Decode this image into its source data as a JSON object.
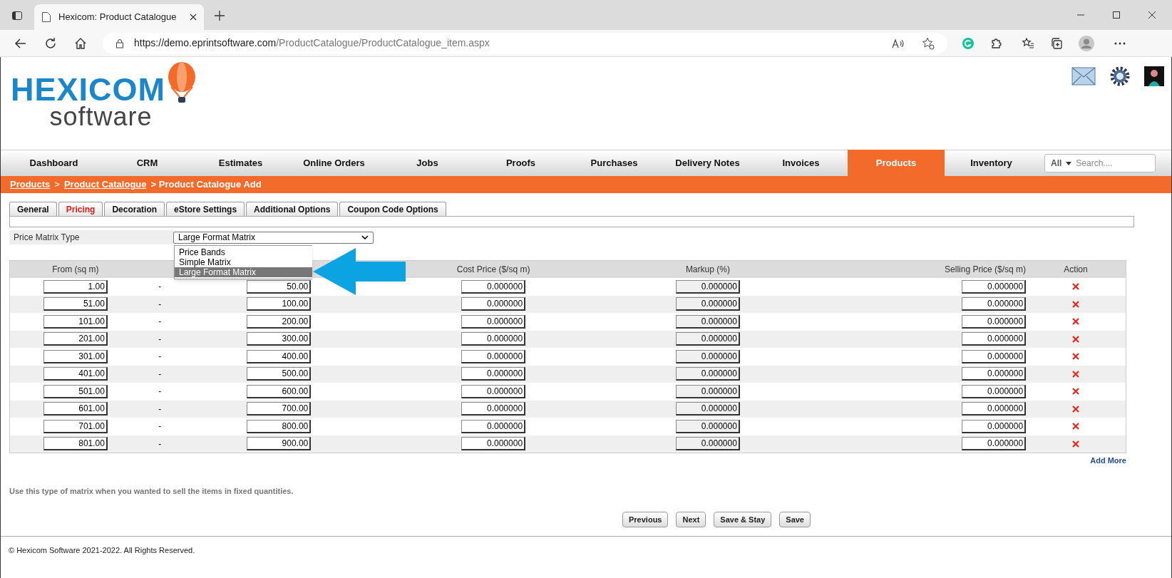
{
  "browser": {
    "tab_title": "Hexicom: Product Catalogue",
    "url_host": "https://demo.eprintsoftware.com",
    "url_path": "/ProductCatalogue/ProductCatalogue_item.aspx"
  },
  "logo": {
    "word": "HEXICOM",
    "sub": "software"
  },
  "nav": [
    {
      "label": "Dashboard",
      "selected": false
    },
    {
      "label": "CRM",
      "selected": false
    },
    {
      "label": "Estimates",
      "selected": false
    },
    {
      "label": "Online Orders",
      "selected": false
    },
    {
      "label": "Jobs",
      "selected": false
    },
    {
      "label": "Proofs",
      "selected": false
    },
    {
      "label": "Purchases",
      "selected": false
    },
    {
      "label": "Delivery Notes",
      "selected": false
    },
    {
      "label": "Invoices",
      "selected": false
    },
    {
      "label": "Products",
      "selected": true
    },
    {
      "label": "Inventory",
      "selected": false
    }
  ],
  "search": {
    "scope": "All",
    "placeholder": "Search...."
  },
  "breadcrumb": [
    {
      "label": "Products",
      "kind": "link"
    },
    {
      "label": ">",
      "kind": "sep"
    },
    {
      "label": "Product Catalogue",
      "kind": "link"
    },
    {
      "label": "> Product Catalogue Add",
      "kind": "current"
    }
  ],
  "tabs": [
    {
      "label": "General",
      "selected": false
    },
    {
      "label": "Pricing",
      "selected": true
    },
    {
      "label": "Decoration",
      "selected": false
    },
    {
      "label": "eStore Settings",
      "selected": false
    },
    {
      "label": "Additional Options",
      "selected": false
    },
    {
      "label": "Coupon Code Options",
      "selected": false
    }
  ],
  "price_matrix_type": {
    "label": "Price Matrix Type",
    "value": "Large Format Matrix",
    "options": [
      {
        "label": "Price Bands",
        "selected": false
      },
      {
        "label": "Simple Matrix",
        "selected": false
      },
      {
        "label": "Large Format Matrix",
        "selected": true
      }
    ]
  },
  "table": {
    "columns": {
      "from": "From (sq m)",
      "cost": "Cost Price ($/sq m)",
      "markup": "Markup (%)",
      "selling": "Selling Price ($/sq m)",
      "action": "Action"
    },
    "rows": [
      {
        "from": "1.00",
        "sep": "-",
        "to": "50.00",
        "cost": "0.000000",
        "markup": "0.000000",
        "selling": "0.000000",
        "markup_disabled": true
      },
      {
        "from": "51.00",
        "sep": "-",
        "to": "100.00",
        "cost": "0.000000",
        "markup": "0.000000",
        "selling": "0.000000",
        "markup_disabled": true
      },
      {
        "from": "101.00",
        "sep": "-",
        "to": "200.00",
        "cost": "0.000000",
        "markup": "0.000000",
        "selling": "0.000000",
        "markup_disabled": true
      },
      {
        "from": "201.00",
        "sep": "-",
        "to": "300.00",
        "cost": "0.000000",
        "markup": "0.000000",
        "selling": "0.000000",
        "markup_disabled": true
      },
      {
        "from": "301.00",
        "sep": "-",
        "to": "400.00",
        "cost": "0.000000",
        "markup": "0.000000",
        "selling": "0.000000",
        "markup_disabled": true
      },
      {
        "from": "401.00",
        "sep": "-",
        "to": "500.00",
        "cost": "0.000000",
        "markup": "0.000000",
        "selling": "0.000000",
        "markup_disabled": true
      },
      {
        "from": "501.00",
        "sep": "-",
        "to": "600.00",
        "cost": "0.000000",
        "markup": "0.000000",
        "selling": "0.000000",
        "markup_disabled": true
      },
      {
        "from": "601.00",
        "sep": "-",
        "to": "700.00",
        "cost": "0.000000",
        "markup": "0.000000",
        "selling": "0.000000",
        "markup_disabled": true
      },
      {
        "from": "701.00",
        "sep": "-",
        "to": "800.00",
        "cost": "0.000000",
        "markup": "0.000000",
        "selling": "0.000000",
        "markup_disabled": true
      },
      {
        "from": "801.00",
        "sep": "-",
        "to": "900.00",
        "cost": "0.000000",
        "markup": "0.000000",
        "selling": "0.000000",
        "markup_disabled": true
      }
    ],
    "add_more": "Add More"
  },
  "note": "Use this type of matrix when you wanted to sell the items in fixed quantities.",
  "buttons": [
    "Previous",
    "Next",
    "Save & Stay",
    "Save"
  ],
  "footer": "© Hexicom Software 2021-2022. All Rights Reserved."
}
